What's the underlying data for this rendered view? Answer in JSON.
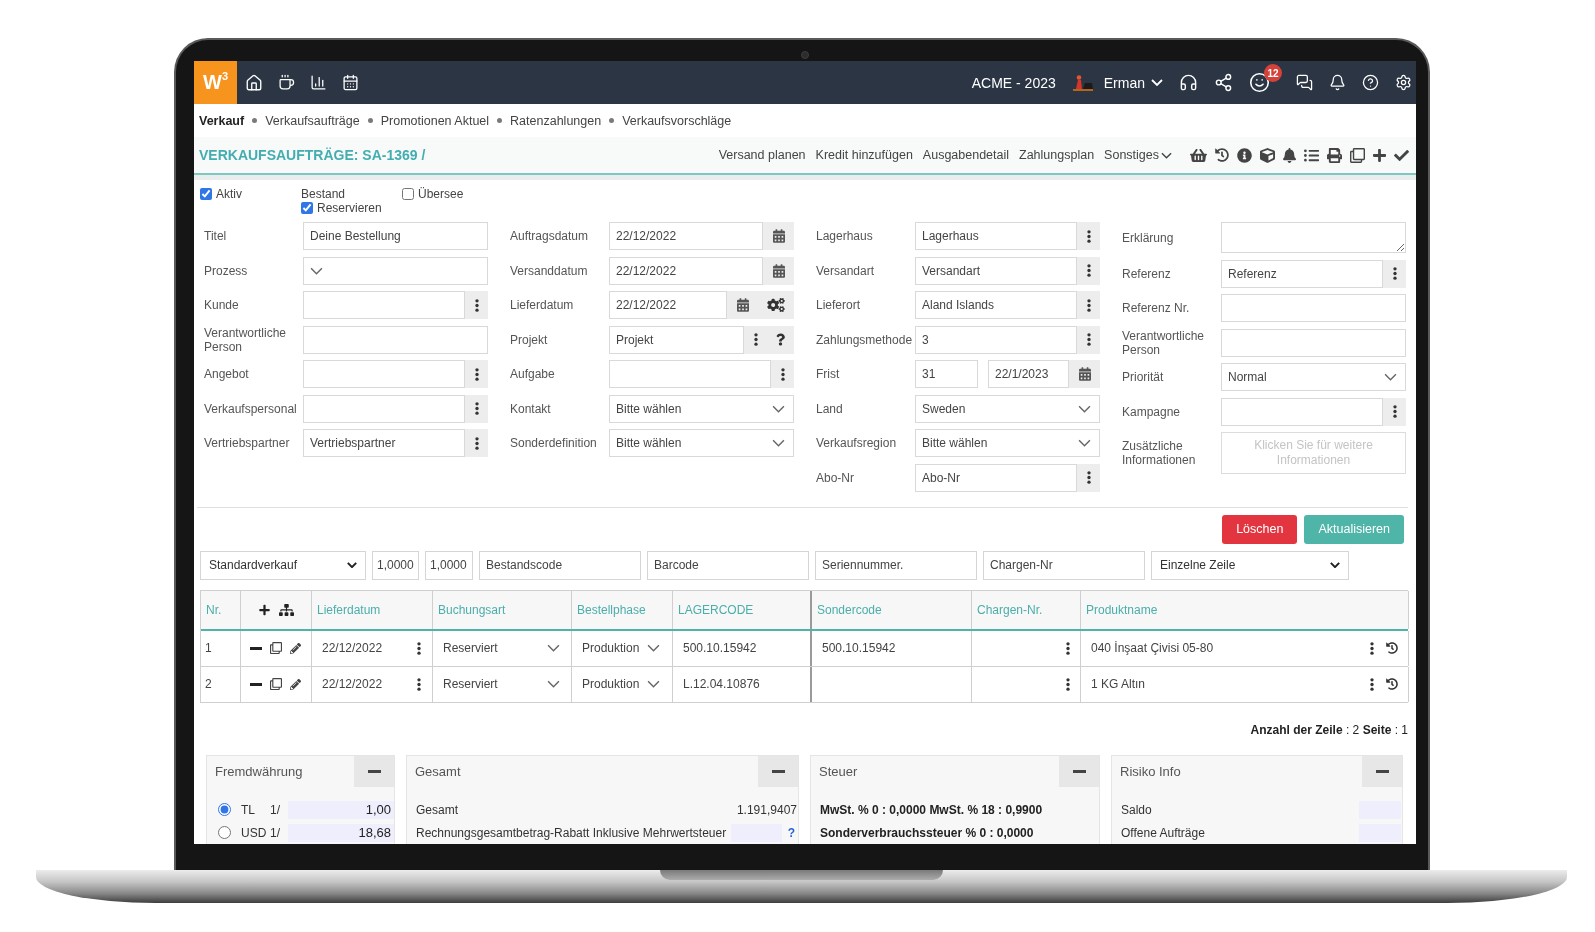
{
  "topbar": {
    "logo": "W$^{3}$",
    "company": "ACME - 2023",
    "user": "Erman",
    "badge": "12"
  },
  "breadcrumb": [
    {
      "label": "Verkauf",
      "selected": true
    },
    {
      "label": "Verkaufsaufträge",
      "selected": false
    },
    {
      "label": "Promotionen Aktuel",
      "selected": false
    },
    {
      "label": "Ratenzahlungen",
      "selected": false
    },
    {
      "label": "Verkaufsvorschläge",
      "selected": false
    }
  ],
  "page_title": "VERKAUFSAUFTRÄGE: SA-1369 /",
  "actions": [
    {
      "label": "Versand planen",
      "kind": "link"
    },
    {
      "label": "Kredit hinzufügen",
      "kind": "link"
    },
    {
      "label": "Ausgabendetail",
      "kind": "link"
    },
    {
      "label": "Zahlungsplan",
      "kind": "link"
    },
    {
      "label": "Sonstiges",
      "kind": "menu"
    }
  ],
  "options": [
    {
      "kind": "checkbox",
      "label": "Aktiv",
      "checked": true
    },
    {
      "kind": "group",
      "label": "Bestand",
      "items": [
        {
          "label": "Reservieren",
          "checked": true
        }
      ]
    },
    {
      "kind": "checkbox",
      "label": "Übersee",
      "checked": false
    }
  ],
  "form": {
    "columns": [
      [
        {
          "label": "Titel",
          "kind": "text",
          "value": "Deine Bestellung"
        },
        {
          "label": "Prozess",
          "kind": "select"
        },
        {
          "label": "Kunde",
          "kind": "lookup"
        },
        {
          "label": "Verantwortliche Person",
          "kind": "text"
        },
        {
          "label": "Angebot",
          "kind": "lookup"
        },
        {
          "label": "Verkaufspersonal",
          "kind": "lookup"
        },
        {
          "label": "Vertriebspartner",
          "kind": "lookup",
          "value": "Vertriebspartner"
        }
      ],
      [
        {
          "label": "Auftragsdatum",
          "kind": "date",
          "value": "22/12/2022"
        },
        {
          "label": "Versanddatum",
          "kind": "date",
          "value": "22/12/2022"
        },
        {
          "label": "Lieferdatum",
          "kind": "date_plan",
          "value": "22/12/2022"
        },
        {
          "label": "Projekt",
          "kind": "lookup_help",
          "value": "Projekt"
        },
        {
          "label": "Aufgabe",
          "kind": "lookup"
        },
        {
          "label": "Kontakt",
          "kind": "select",
          "value": "Bitte wählen"
        },
        {
          "label": "Sonderdefinition",
          "kind": "select",
          "value": "Bitte wählen"
        }
      ],
      [
        {
          "label": "Lagerhaus",
          "kind": "lookup",
          "value": "Lagerhaus"
        },
        {
          "label": "Versandart",
          "kind": "lookup",
          "value": "Versandart"
        },
        {
          "label": "Lieferort",
          "kind": "lookup",
          "value": "Aland Islands"
        },
        {
          "label": "Zahlungsmethode",
          "kind": "lookup",
          "value": "3"
        },
        {
          "label": "Frist",
          "kind": "deadline",
          "days": "31",
          "date": "22/1/2023"
        },
        {
          "label": "Land",
          "kind": "select",
          "value": "Sweden"
        },
        {
          "label": "Verkaufsregion",
          "kind": "select",
          "value": "Bitte wählen"
        },
        {
          "label": "Abo-Nr",
          "kind": "lookup",
          "value": "Abo-Nr"
        }
      ],
      [
        {
          "label": "Erklärung",
          "kind": "textarea"
        },
        {
          "label": "Referenz",
          "kind": "lookup",
          "value": "Referenz"
        },
        {
          "label": "Referenz Nr.",
          "kind": "text"
        },
        {
          "label": "Verantwortliche Person",
          "kind": "text"
        },
        {
          "label": "Priorität",
          "kind": "select",
          "value": "Normal"
        },
        {
          "label": "Kampagne",
          "kind": "lookup"
        },
        {
          "label": "Zusätzliche Informationen",
          "kind": "info",
          "hint": "Klicken Sie für weitere Informationen"
        }
      ]
    ]
  },
  "buttons": [
    {
      "label": "Löschen",
      "kind": "danger"
    },
    {
      "label": "Aktualisieren",
      "kind": "primary"
    }
  ],
  "line_inputs": [
    {
      "kind": "select",
      "value": "Standardverkauf"
    },
    {
      "kind": "number",
      "value": "1,0000"
    },
    {
      "kind": "number",
      "value": "1,0000"
    },
    {
      "kind": "text",
      "value": "Bestandscode"
    },
    {
      "kind": "text",
      "value": "Barcode"
    },
    {
      "kind": "text",
      "value": "Seriennummer."
    },
    {
      "kind": "text",
      "value": "Chargen-Nr"
    },
    {
      "kind": "select",
      "value": "Einzelne Zeile"
    }
  ],
  "table": {
    "columns": [
      {
        "kind": "text",
        "label": "Nr."
      },
      {
        "kind": "actions"
      },
      {
        "kind": "text",
        "label": "Lieferdatum"
      },
      {
        "kind": "text",
        "label": "Buchungsart"
      },
      {
        "kind": "text",
        "label": "Bestellphase"
      },
      {
        "kind": "text",
        "label": "LAGERCODE"
      },
      {
        "kind": "text",
        "label": "Sondercode"
      },
      {
        "kind": "text",
        "label": "Chargen-Nr."
      },
      {
        "kind": "text",
        "label": "Produktname"
      }
    ],
    "rows": [
      {
        "nr": "1",
        "lieferdatum": "22/12/2022",
        "buchungsart": "Reserviert",
        "bestellphase": "Produktion",
        "lagercode": "500.10.15942",
        "sondercode": "500.10.15942",
        "produktname": "040 İnşaat Çivisi 05-80"
      },
      {
        "nr": "2",
        "lieferdatum": "22/12/2022",
        "buchungsart": "Reserviert",
        "bestellphase": "Produktion",
        "lagercode": "L.12.04.10876",
        "produktname": "1 KG Altın"
      }
    ]
  },
  "pager": "**Anzahl der Zeile** : 2 **Seite** : 1",
  "panels": [
    {
      "kind": "currency",
      "title": "Fremdwährung",
      "expanded": true,
      "rates": [
        {
          "code": "TL",
          "selected": true,
          "ratio": "1/",
          "value": "1,00"
        },
        {
          "code": "USD",
          "selected": false,
          "ratio": "1/",
          "value": "18,68"
        }
      ]
    },
    {
      "kind": "totals",
      "title": "Gesamt",
      "expanded": true,
      "rows": [
        {
          "kind": "value",
          "label": "Gesamt",
          "value": "1.191,9407"
        },
        {
          "kind": "input",
          "label": "Rechnungsgesamtbetrag-Rabatt Inklusive Mehrwertsteuer",
          "help": "?"
        }
      ]
    },
    {
      "kind": "tax",
      "title": "Steuer",
      "expanded": true,
      "lines": [
        "MwSt. % 0 : 0,0000 MwSt. % 18 : 0,9900",
        "Sonderverbrauchssteuer % 0 : 0,0000"
      ]
    },
    {
      "kind": "risk",
      "title": "Risiko Info",
      "expanded": true,
      "rows": [
        {
          "label": "Saldo"
        },
        {
          "label": "Offene Aufträge"
        }
      ]
    }
  ]
}
